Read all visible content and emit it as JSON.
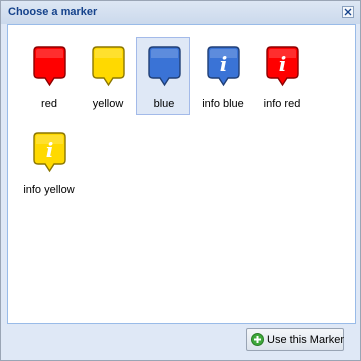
{
  "window": {
    "title": "Choose a marker",
    "close_icon": "close-icon"
  },
  "markers": [
    {
      "label": "red",
      "color": "#ff0000",
      "info": false,
      "selected": false
    },
    {
      "label": "yellow",
      "color": "#ffd900",
      "info": false,
      "selected": false
    },
    {
      "label": "blue",
      "color": "#3a73d6",
      "info": false,
      "selected": true
    },
    {
      "label": "info blue",
      "color": "#3a73d6",
      "info": true,
      "selected": false
    },
    {
      "label": "info red",
      "color": "#ff0000",
      "info": true,
      "selected": false
    },
    {
      "label": "info yellow",
      "color": "#ffd900",
      "info": true,
      "selected": false
    }
  ],
  "footer": {
    "use_button_label": "Use this Marker",
    "use_button_icon": "plus-circle-icon"
  }
}
